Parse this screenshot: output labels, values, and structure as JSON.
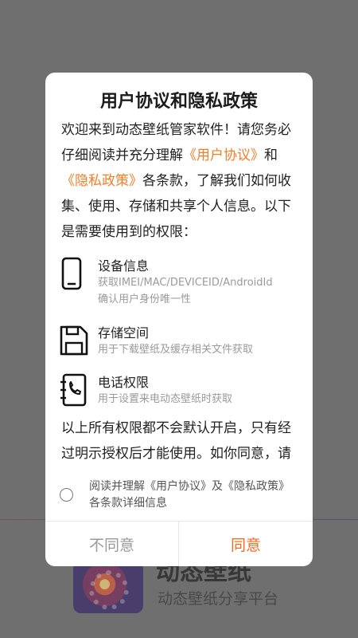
{
  "background": {
    "app_name": "动态壁纸",
    "app_slogan": "动态壁纸分享平台"
  },
  "dialog": {
    "title": "用户协议和隐私政策",
    "intro": {
      "part1": "欢迎来到动态壁纸管家软件！请您务必仔细阅读并充分理解",
      "user_agreement_link": "《用户协议》",
      "part2": "和",
      "privacy_link": "《隐私政策》",
      "part3": "各条款，了解我们如何收集、使用、存储和共享个人信息。以下是需要使用到的权限："
    },
    "permissions": [
      {
        "name": "设备信息",
        "desc_line1": "获取IMEI/MAC/DEVICEID/AndroidId",
        "desc_line2": "确认用户身份唯一性",
        "icon": "phone-icon"
      },
      {
        "name": "存储空间",
        "desc_line1": "用于下载壁纸及缓存相关文件获取",
        "icon": "floppy-disk-icon"
      },
      {
        "name": "电话权限",
        "desc_line1": "用于设置来电动态壁纸时获取",
        "icon": "phone-book-icon"
      }
    ],
    "notice": "以上所有权限都不会默认开启，只有经过明示授权后才能使用。如你同意，请",
    "agree_checkbox": {
      "line1": "阅读并理解《用户协议》及《隐私政策》",
      "line2": "各条款详细信息",
      "checked": false
    },
    "buttons": {
      "disagree": "不同意",
      "agree": "同意"
    },
    "accent_color": "#ff6a1a"
  }
}
